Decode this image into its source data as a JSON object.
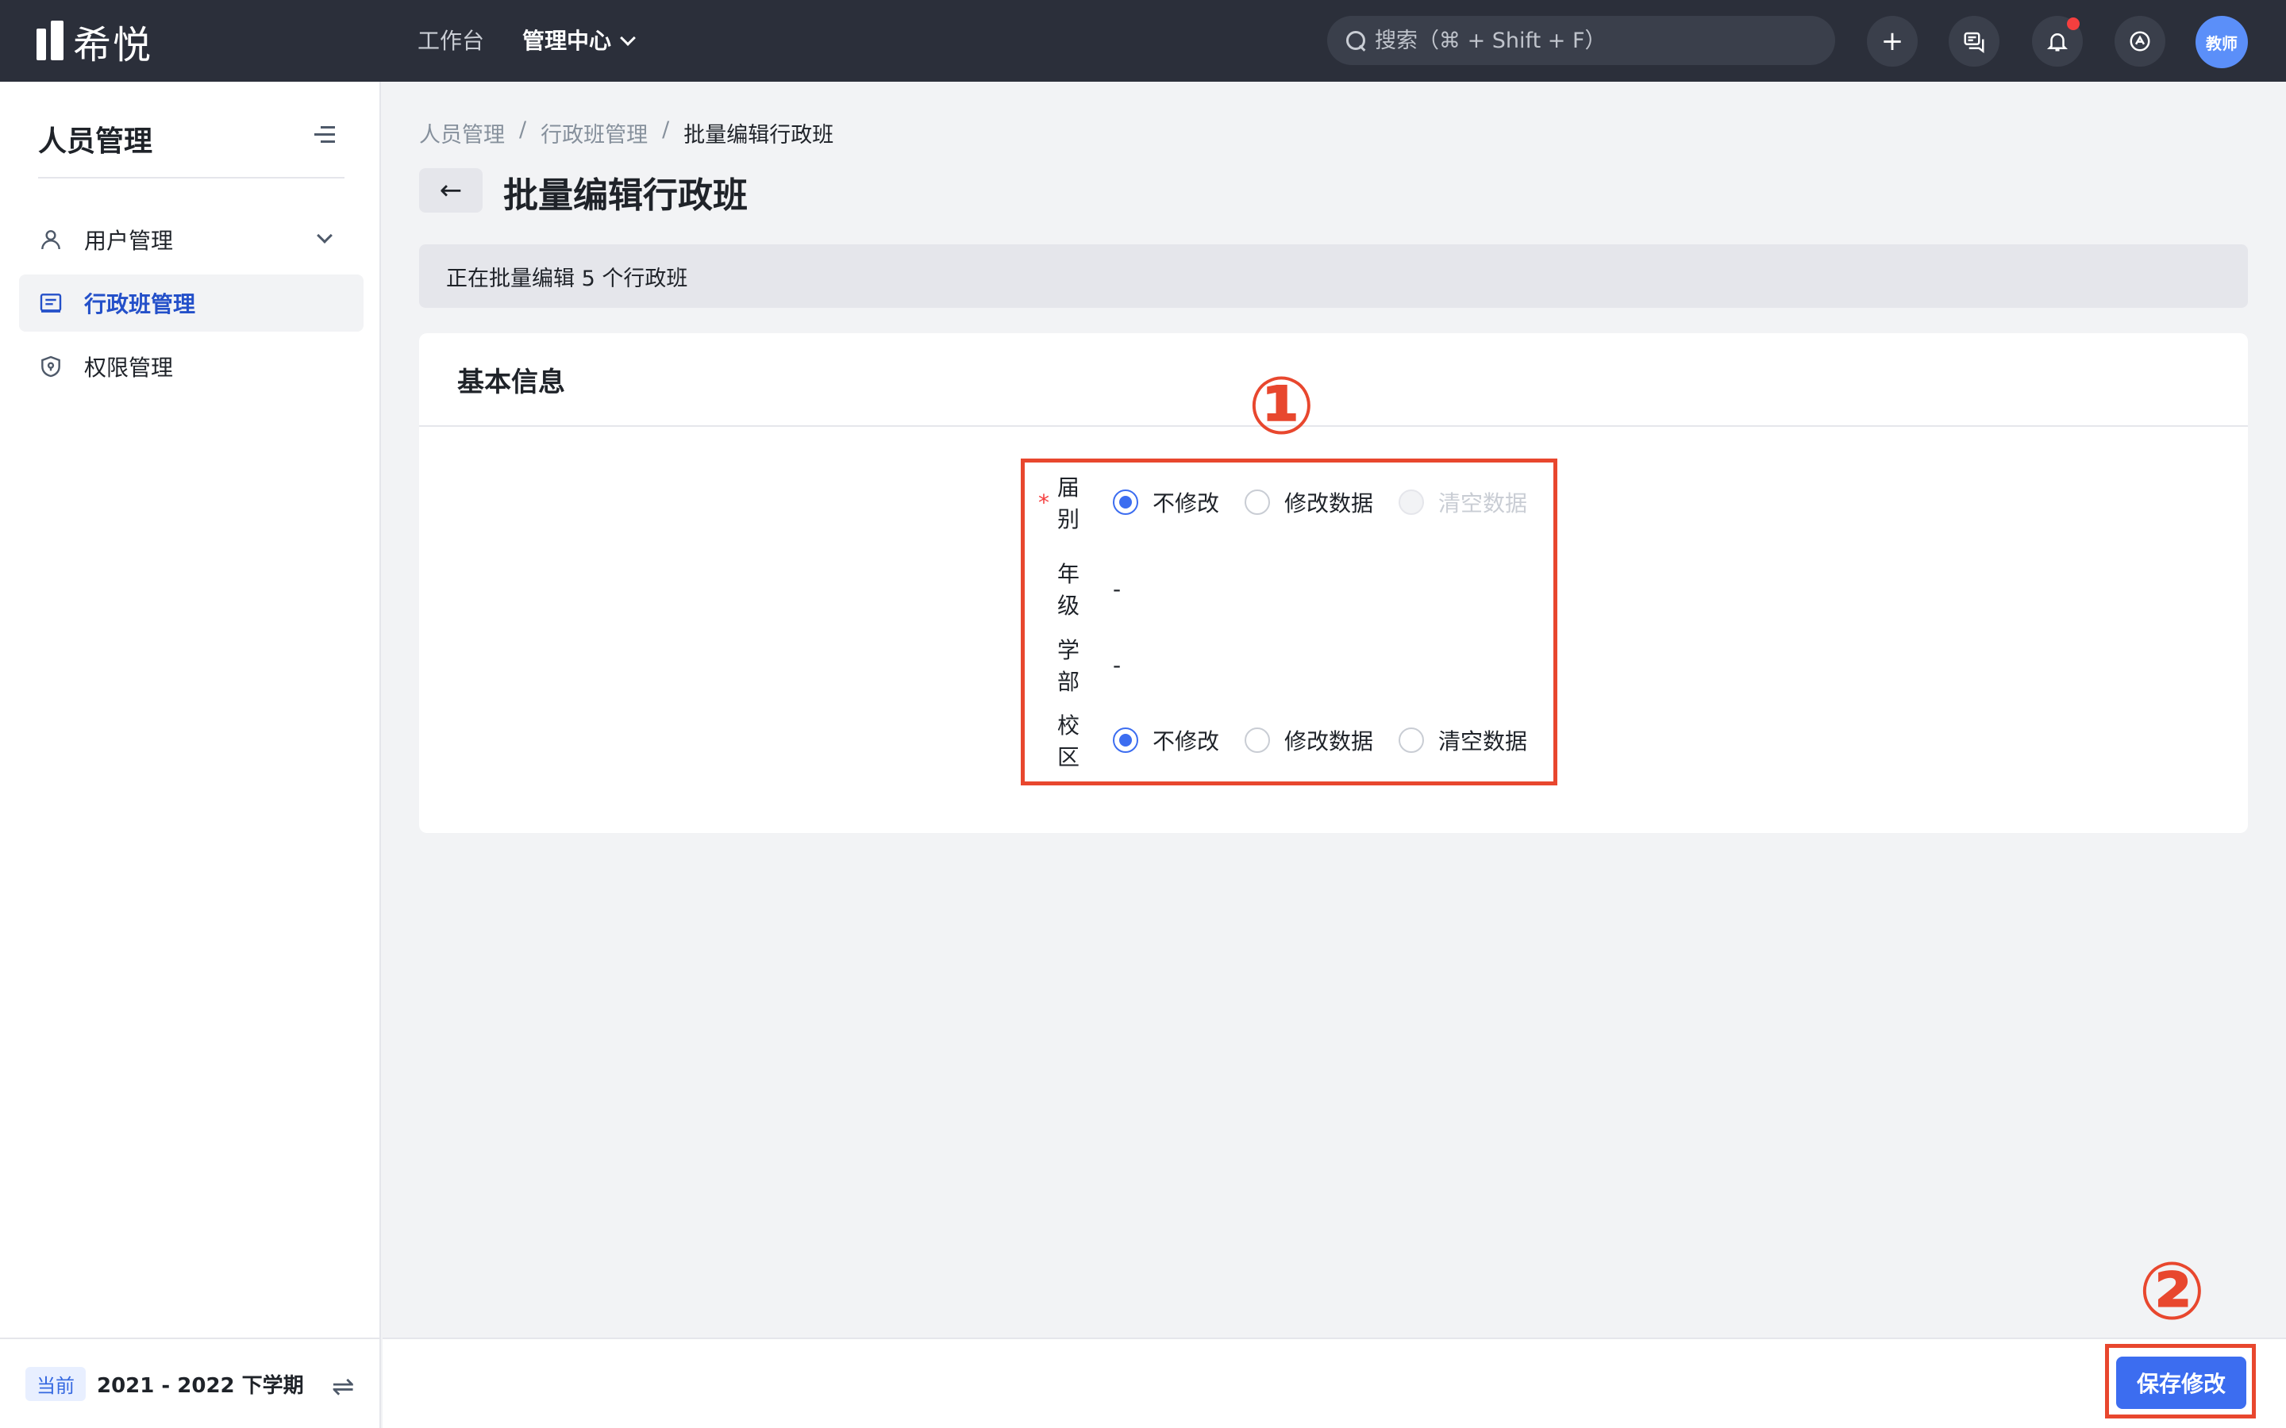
{
  "app": {
    "logo_text": "希悦"
  },
  "topnav": {
    "workspace": "工作台",
    "admin_center": "管理中心",
    "search_placeholder": "搜索（⌘ + Shift + F）",
    "plus": "+",
    "avatar_text": "教师"
  },
  "sidebar": {
    "title": "人员管理",
    "items": [
      {
        "label": "用户管理",
        "icon": "user-icon"
      },
      {
        "label": "行政班管理",
        "icon": "class-list-icon",
        "active": true
      },
      {
        "label": "权限管理",
        "icon": "shield-icon"
      }
    ],
    "footer": {
      "tag": "当前",
      "term": "2021 - 2022 下学期",
      "swap": "⇌"
    }
  },
  "breadcrumb": {
    "items": [
      "人员管理",
      "行政班管理",
      "批量编辑行政班"
    ],
    "separator": "/"
  },
  "page": {
    "title": "批量编辑行政班",
    "back": "←",
    "notice": "正在批量编辑 5 个行政班"
  },
  "card": {
    "title": "基本信息",
    "fields": {
      "session": {
        "required": "*",
        "label": "届别",
        "options": [
          "不修改",
          "修改数据",
          "清空数据"
        ],
        "selected": "不修改"
      },
      "grade": {
        "label": "年级",
        "value": "-"
      },
      "department": {
        "label": "学部",
        "value": "-"
      },
      "campus": {
        "label": "校区",
        "options": [
          "不修改",
          "修改数据",
          "清空数据"
        ],
        "selected": "不修改"
      }
    }
  },
  "annotations": {
    "one": "①",
    "two": "②"
  },
  "footer": {
    "save_label": "保存修改"
  },
  "colors": {
    "topbar": "#2b2f3a",
    "primary": "#3c6df0",
    "annotation": "#e8472e",
    "active_text": "#2450c9"
  }
}
